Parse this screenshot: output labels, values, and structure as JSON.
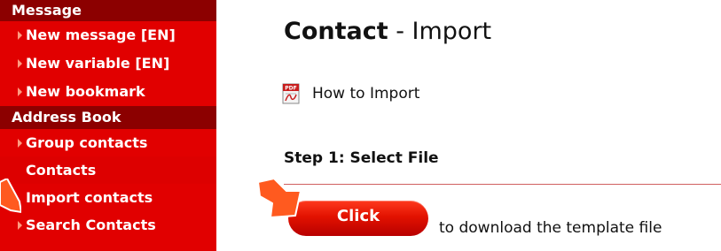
{
  "sidebar": {
    "sections": [
      {
        "header": "Message",
        "items": [
          {
            "label": "New message [EN]"
          },
          {
            "label": "New variable [EN]"
          },
          {
            "label": "New bookmark"
          }
        ]
      },
      {
        "header": "Address Book",
        "items": [
          {
            "label": "Group contacts"
          },
          {
            "label": "Contacts"
          },
          {
            "label": "Import contacts"
          },
          {
            "label": "Search Contacts"
          }
        ]
      }
    ]
  },
  "main": {
    "title_strong": "Contact",
    "title_rest": " - Import",
    "howto_label": "How to Import",
    "step1_title": "Step 1: Select File",
    "click_button_label": "Click",
    "download_text": "to download the template file"
  },
  "colors": {
    "sidebar_bg": "#e10000",
    "section_header_bg": "#8c0000",
    "button_red": "#e21200",
    "arrow_orange": "#ff5a1f",
    "divider": "#d06060"
  },
  "icons": {
    "pdf": "pdf-file-icon",
    "nav_bullet": "triangle-right-icon",
    "pointer": "orange-pointer-arrow-icon"
  }
}
